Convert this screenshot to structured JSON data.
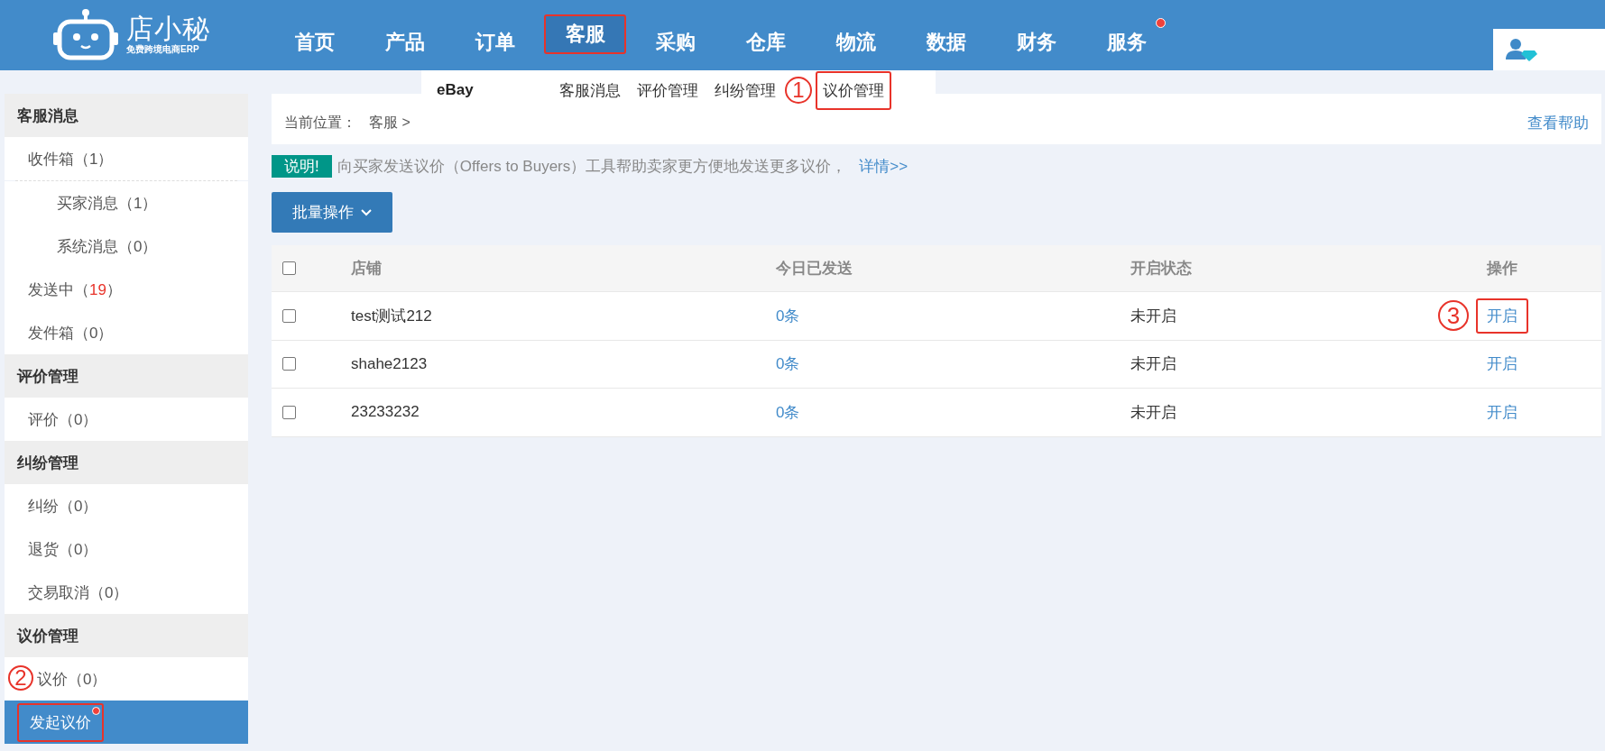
{
  "header": {
    "logo": {
      "name": "店小秘",
      "tagline": "免费跨境电商ERP"
    },
    "nav": [
      {
        "label": "首页",
        "selected": false,
        "highlighted": false,
        "dot": false
      },
      {
        "label": "产品",
        "selected": false,
        "highlighted": false,
        "dot": false
      },
      {
        "label": "订单",
        "selected": false,
        "highlighted": false,
        "dot": false
      },
      {
        "label": "客服",
        "selected": true,
        "highlighted": true,
        "dot": false
      },
      {
        "label": "采购",
        "selected": false,
        "highlighted": false,
        "dot": false
      },
      {
        "label": "仓库",
        "selected": false,
        "highlighted": false,
        "dot": false
      },
      {
        "label": "物流",
        "selected": false,
        "highlighted": false,
        "dot": false
      },
      {
        "label": "数据",
        "selected": false,
        "highlighted": false,
        "dot": false
      },
      {
        "label": "财务",
        "selected": false,
        "highlighted": false,
        "dot": false
      },
      {
        "label": "服务",
        "selected": false,
        "highlighted": false,
        "dot": true
      }
    ]
  },
  "dropdown": {
    "platform": "eBay",
    "items": [
      {
        "label": "客服消息",
        "highlighted": false
      },
      {
        "label": "评价管理",
        "highlighted": false
      },
      {
        "label": "纠纷管理",
        "highlighted": false
      },
      {
        "label": "议价管理",
        "highlighted": true,
        "marker": "1"
      }
    ]
  },
  "sidebar": {
    "sections": [
      {
        "title": "客服消息",
        "items": [
          {
            "label": "收件箱",
            "count": "（1）",
            "alert": false,
            "selected": false,
            "dot": false,
            "highlighted": false,
            "children": [
              {
                "label": "买家消息",
                "count": "（1）",
                "alert": false,
                "selected": false,
                "dot": false,
                "highlighted": false
              },
              {
                "label": "系统消息",
                "count": "（0）",
                "alert": false,
                "selected": false,
                "dot": false,
                "highlighted": false
              }
            ]
          },
          {
            "label": "发送中",
            "prefix": "（",
            "count": "19",
            "suffix": "）",
            "alert": true,
            "selected": false,
            "dot": false,
            "highlighted": false
          },
          {
            "label": "发件箱",
            "count": "（0）",
            "alert": false,
            "selected": false,
            "dot": false,
            "highlighted": false
          }
        ]
      },
      {
        "title": "评价管理",
        "items": [
          {
            "label": "评价",
            "count": "（0）",
            "alert": false,
            "selected": false,
            "dot": false,
            "highlighted": false
          }
        ]
      },
      {
        "title": "纠纷管理",
        "items": [
          {
            "label": "纠纷",
            "count": "（0）",
            "alert": false,
            "selected": false,
            "dot": false,
            "highlighted": false
          },
          {
            "label": "退货",
            "count": "（0）",
            "alert": false,
            "selected": false,
            "dot": false,
            "highlighted": false
          },
          {
            "label": "交易取消",
            "count": "（0）",
            "alert": false,
            "selected": false,
            "dot": false,
            "highlighted": false
          }
        ]
      },
      {
        "title": "议价管理",
        "items": [
          {
            "label": "议价",
            "count": "（0）",
            "alert": false,
            "selected": false,
            "dot": false,
            "highlighted": false,
            "marker": "2"
          },
          {
            "label": "发起议价",
            "selected": true,
            "dot": true,
            "highlighted": true
          }
        ]
      }
    ]
  },
  "breadcrumb": {
    "label": "当前位置：",
    "path": "客服 >",
    "help": "查看帮助"
  },
  "notice": {
    "tag": "说明!",
    "text": "向买家发送议价（Offers to Buyers）工具帮助卖家更方便地发送更多议价，",
    "link": "详情>>"
  },
  "batch_button": "批量操作",
  "table": {
    "all_checked": false,
    "columns": [
      "店铺",
      "今日已发送",
      "开启状态",
      "操作"
    ],
    "rows": [
      {
        "checked": false,
        "shop": "test测试212",
        "sent": "0条",
        "status": "未开启",
        "action": "开启",
        "highlighted": true,
        "marker": "3"
      },
      {
        "checked": false,
        "shop": "shahe2123",
        "sent": "0条",
        "status": "未开启",
        "action": "开启",
        "highlighted": false
      },
      {
        "checked": false,
        "shop": "23233232",
        "sent": "0条",
        "status": "未开启",
        "action": "开启",
        "highlighted": false
      }
    ]
  }
}
